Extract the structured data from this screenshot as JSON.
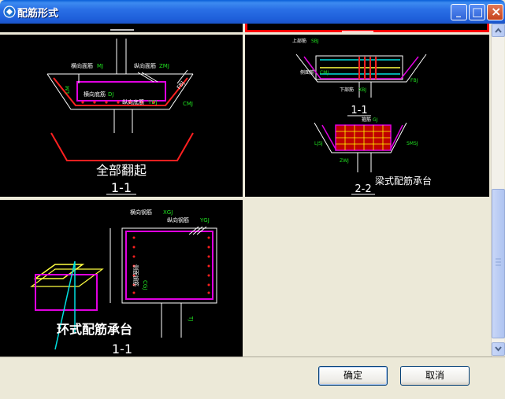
{
  "window": {
    "title": "配筋形式",
    "minimize_glyph": "_",
    "maximize_glyph": "□",
    "close_glyph": "×"
  },
  "panels": {
    "top_left": {
      "caption": "全部翻起",
      "section": "1-1",
      "labels": {
        "heng_mian": "横向面筋",
        "mj": "MJ",
        "zong_mian": "纵向面筋",
        "zmj": "ZMJ",
        "heng_di": "横向底筋",
        "dj": "DJ",
        "zong_di": "纵向底筋",
        "ydj": "YDJ",
        "cmj": "CMJ",
        "fbj": "FBJ",
        "lm": "LM"
      }
    },
    "top_right": {
      "caption": "梁式配筋承台",
      "section_upper": "1-1",
      "section_lower": "2-2",
      "labels": {
        "shang_bu": "上部筋",
        "sbj": "SBJ",
        "ce_mian": "侧面筋",
        "cmj": "CMJ",
        "xia_bu": "下部筋",
        "xbj": "XBJ",
        "gu_jin": "箍筋",
        "gj": "GJ",
        "fbj": "FBJ",
        "ljsj": "LJSJ",
        "smsj": "SMSJ",
        "zwj": "ZWJ"
      }
    },
    "bottom_left": {
      "caption": "环式配筋承台",
      "section": "1-1",
      "labels": {
        "heng_xiang": "横向钢筋",
        "xgj": "XGJ",
        "zong_xiang": "纵向钢筋",
        "ygj": "YGJ",
        "hu_bi": "侧面钢筋",
        "cgj": "CGJ",
        "tj": "TJ"
      }
    }
  },
  "buttons": {
    "ok": "确定",
    "cancel": "取消"
  },
  "colors": {
    "title_bar": "#2A6FE6",
    "drawing_bg": "#000000",
    "rebar_magenta": "#E000E0",
    "rebar_red": "#FF2020",
    "annot_green": "#20E020",
    "line_white": "#FFFFFF",
    "selected_border": "#FF0000"
  }
}
